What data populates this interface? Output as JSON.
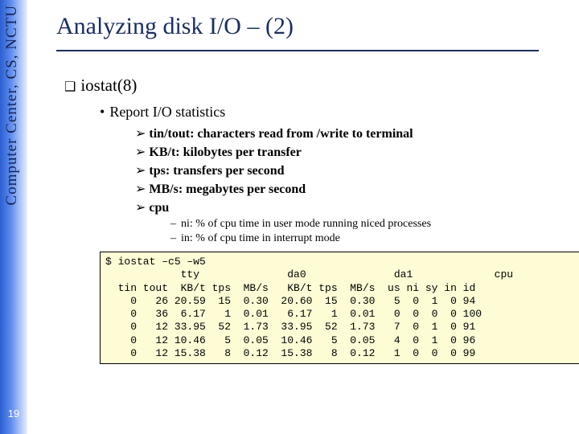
{
  "side": {
    "label": "Computer Center, CS, NCTU"
  },
  "pagenum": "19",
  "title": "Analyzing disk I/O – (2)",
  "bullets": {
    "l1": "iostat(8)",
    "l2": "Report I/O statistics",
    "l3a": "tin/tout: characters read from /write to terminal",
    "l3b": "KB/t: kilobytes per transfer",
    "l3c": "tps: transfers per second",
    "l3d": "MB/s: megabytes per second",
    "l3e": "cpu",
    "l4a": "ni: % of cpu time in user mode running niced processes",
    "l4b": "in: % of cpu time in interrupt mode"
  },
  "code": {
    "cmd": "$ iostat –c5 –w5",
    "header1": "            tty              da0              da1             cpu",
    "header2": "  tin tout  KB/t tps  MB/s   KB/t tps  MB/s  us ni sy in id",
    "rows": [
      "    0   26 20.59  15  0.30  20.60  15  0.30   5  0  1  0 94",
      "    0   36  6.17   1  0.01   6.17   1  0.01   0  0  0  0 100",
      "    0   12 33.95  52  1.73  33.95  52  1.73   7  0  1  0 91",
      "    0   12 10.46   5  0.05  10.46   5  0.05   4  0  1  0 96",
      "    0   12 15.38   8  0.12  15.38   8  0.12   1  0  0  0 99"
    ]
  },
  "chart_data": {
    "type": "table",
    "title": "iostat -c5 -w5",
    "columns": [
      "tin",
      "tout",
      "da0_KB/t",
      "da0_tps",
      "da0_MB/s",
      "da1_KB/t",
      "da1_tps",
      "da1_MB/s",
      "us",
      "ni",
      "sy",
      "in",
      "id"
    ],
    "rows": [
      [
        0,
        26,
        20.59,
        15,
        0.3,
        20.6,
        15,
        0.3,
        5,
        0,
        1,
        0,
        94
      ],
      [
        0,
        36,
        6.17,
        1,
        0.01,
        6.17,
        1,
        0.01,
        0,
        0,
        0,
        0,
        100
      ],
      [
        0,
        12,
        33.95,
        52,
        1.73,
        33.95,
        52,
        1.73,
        7,
        0,
        1,
        0,
        91
      ],
      [
        0,
        12,
        10.46,
        5,
        0.05,
        10.46,
        5,
        0.05,
        4,
        0,
        1,
        0,
        96
      ],
      [
        0,
        12,
        15.38,
        8,
        0.12,
        15.38,
        8,
        0.12,
        1,
        0,
        0,
        0,
        99
      ]
    ]
  }
}
